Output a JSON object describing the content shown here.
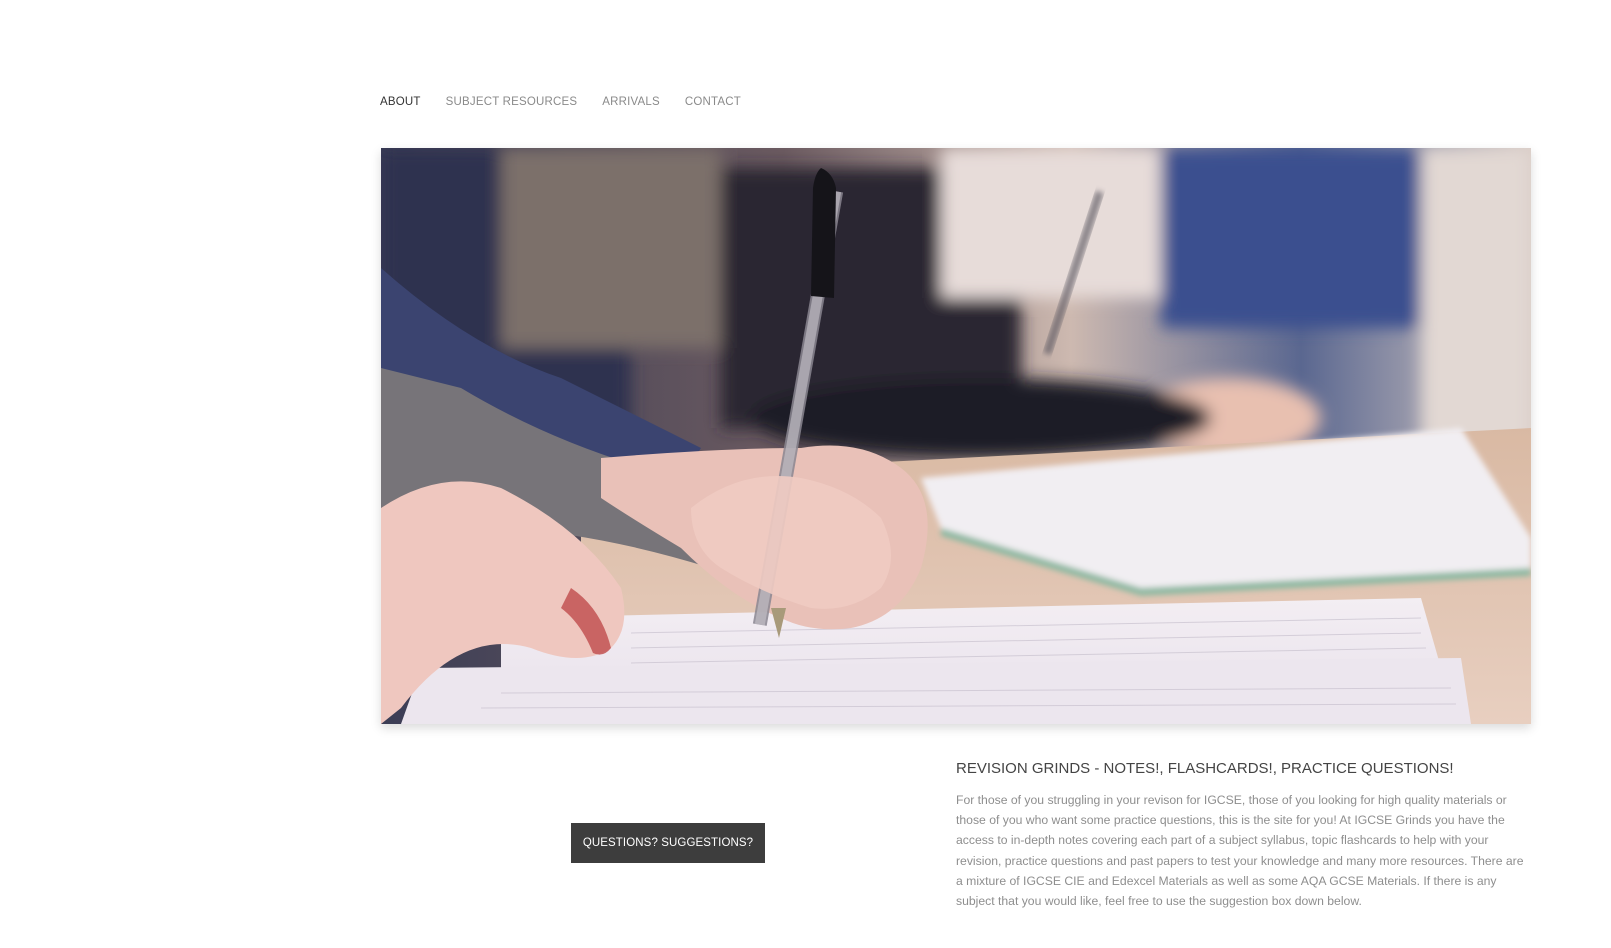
{
  "nav": {
    "items": [
      {
        "label": "ABOUT",
        "active": true
      },
      {
        "label": "SUBJECT RESOURCES",
        "active": false
      },
      {
        "label": "ARRIVALS",
        "active": false
      },
      {
        "label": "CONTACT",
        "active": false
      }
    ]
  },
  "hero": {
    "image": "students-writing-with-pens-photo"
  },
  "cta": {
    "label": "QUESTIONS? SUGGESTIONS?"
  },
  "about": {
    "title": "REVISION GRINDS - NOTES!, FLASHCARDS!, PRACTICE QUESTIONS!",
    "body": "For those of you struggling in your revison for IGCSE, those of you looking for high quality materials or those of you who want some practice questions, this is the site for you! At IGCSE Grinds you have the access to in-depth notes covering each part of a subject syllabus, topic flashcards to help with your revision, practice questions and past papers to test your knowledge and many more resources. There are a mixture of IGCSE CIE and Edexcel Materials as well as some AQA GCSE Materials. If there is any subject that you would like, feel free to use the suggestion box down below."
  },
  "colors": {
    "nav_active": "#333333",
    "nav_inactive": "#8a8a8a",
    "button_bg": "#3d3d3d",
    "body_text": "#8e8e8e"
  }
}
